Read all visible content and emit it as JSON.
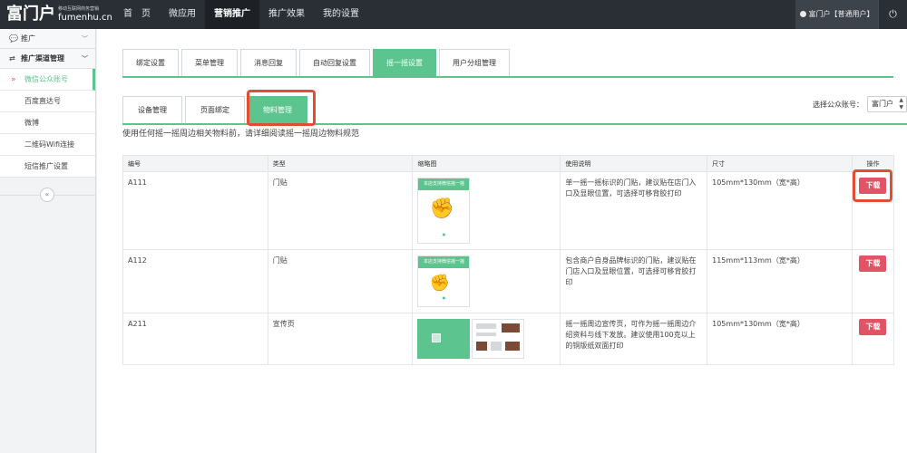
{
  "header": {
    "logo_main": "富门户",
    "logo_tagline": "移动互联网商务营销",
    "logo_domain": "fumenhu.cn",
    "nav": [
      "首　页",
      "微应用",
      "营销推广",
      "推广效果",
      "我的设置"
    ],
    "nav_active": "营销推广",
    "user_label": "富门户【普通用户】",
    "power_icon": "power-icon"
  },
  "sidebar": {
    "groups": [
      {
        "label": "推广",
        "icon": "chat-bubbles-icon"
      },
      {
        "label": "推广渠道管理",
        "icon": "exchange-arrows-icon"
      }
    ],
    "items": [
      {
        "label": "微信公众账号",
        "active": true
      },
      {
        "label": "百度直达号",
        "active": false
      },
      {
        "label": "微博",
        "active": false
      },
      {
        "label": "二维码Wifi连接",
        "active": false
      },
      {
        "label": "短信推广设置",
        "active": false
      }
    ],
    "collapse_icon": "double-chevron-left-icon"
  },
  "tabs_primary": [
    "绑定设置",
    "菜单管理",
    "消息回复",
    "自动回复设置",
    "摇一摇设置",
    "用户分组管理"
  ],
  "tabs_primary_active": "摇一摇设置",
  "tabs_secondary": [
    "设备管理",
    "页面绑定",
    "物料管理"
  ],
  "tabs_secondary_active": "物料管理",
  "account_select": {
    "label": "选择公众账号：",
    "value": "富门户"
  },
  "notice": "使用任何摇一摇周边相关物料前，请详细阅读摇一摇周边物料规范",
  "table": {
    "headers": [
      "编号",
      "类型",
      "缩略图",
      "使用说明",
      "尺寸",
      "操作"
    ],
    "rows": [
      {
        "id": "A111",
        "type": "门贴",
        "thumb_title": "本店支持微信摇一摇",
        "desc": "单一摇一摇标识的门贴，建议贴在店门入口及显眼位置，可选择可移背胶打印",
        "size": "105mm*130mm（宽*高）",
        "action": "下载",
        "highlight": true
      },
      {
        "id": "A112",
        "type": "门贴",
        "thumb_title": "本店支持微信摇一摇",
        "desc": "包含商户自身品牌标识的门贴，建议贴在门店入口及显眼位置，可选择可移背胶打印",
        "size": "115mm*113mm（宽*高）",
        "action": "下载",
        "highlight": false
      },
      {
        "id": "A211",
        "type": "宣传页",
        "thumb_title": "",
        "desc": "摇一摇周边宣传页，可作为摇一摇周边介绍资料与线下发放。建议使用100克以上的铜版纸双面打印",
        "size": "105mm*130mm（宽*高）",
        "action": "下载",
        "highlight": false
      }
    ]
  },
  "colors": {
    "topbar": "#2a2f36",
    "accent_green": "#5cc48e",
    "download_red": "#e05465",
    "highlight_orange": "#e0502f"
  }
}
